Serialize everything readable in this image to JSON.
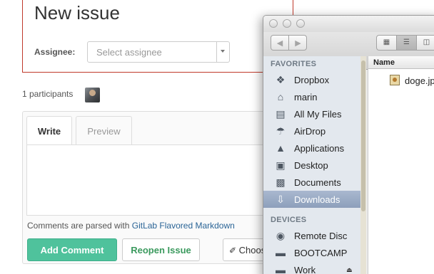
{
  "issue": {
    "title": "New issue",
    "assignee_label": "Assignee:",
    "assignee_placeholder": "Select assignee"
  },
  "participants": {
    "text": "1 participants"
  },
  "comment": {
    "tabs": [
      "Write",
      "Preview"
    ],
    "note_prefix": "Comments are parsed with ",
    "note_link": "GitLab Flavored Markdown",
    "add_button": "Add Comment",
    "reopen_button": "Reopen Issue",
    "choose_button": "Choos"
  },
  "finder": {
    "favorites_header": "FAVORITES",
    "favorites": [
      {
        "label": "Dropbox",
        "icon": "dropbox-icon"
      },
      {
        "label": "marin",
        "icon": "home-icon"
      },
      {
        "label": "All My Files",
        "icon": "all-files-icon"
      },
      {
        "label": "AirDrop",
        "icon": "airdrop-icon"
      },
      {
        "label": "Applications",
        "icon": "applications-icon"
      },
      {
        "label": "Desktop",
        "icon": "desktop-icon"
      },
      {
        "label": "Documents",
        "icon": "documents-icon"
      },
      {
        "label": "Downloads",
        "icon": "downloads-icon",
        "selected": true
      }
    ],
    "devices_header": "DEVICES",
    "devices": [
      {
        "label": "Remote Disc",
        "icon": "disc-icon"
      },
      {
        "label": "BOOTCAMP",
        "icon": "drive-icon"
      },
      {
        "label": "Work",
        "icon": "drive-icon",
        "eject": true
      }
    ],
    "column_header": "Name",
    "files": [
      "doge.jpg"
    ]
  },
  "colors": {
    "accent_green": "#4fc29c",
    "error_border": "#c0392b",
    "link_blue": "#2a6496",
    "finder_selection": "#8d9fbb"
  }
}
